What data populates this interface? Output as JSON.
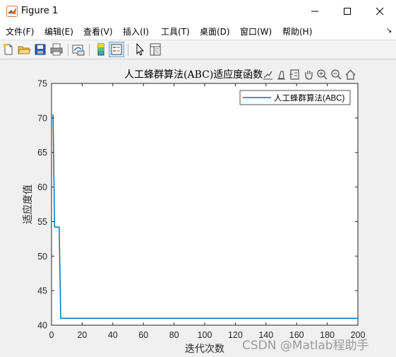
{
  "window": {
    "title": "Figure 1",
    "controls": [
      "minimize-icon",
      "maximize-icon",
      "close-icon"
    ]
  },
  "menu": {
    "items": [
      "文件(F)",
      "编辑(E)",
      "查看(V)",
      "插入(I)",
      "工具(T)",
      "桌面(D)",
      "窗口(W)",
      "帮助(H)"
    ],
    "overflow": "↘"
  },
  "toolbar": {
    "icons": [
      "new-figure-icon",
      "open-file-icon",
      "save-icon",
      "print-icon",
      "link-plot-icon",
      "colorbar-icon",
      "legend-icon",
      "edit-pointer-icon",
      "property-inspector-icon"
    ]
  },
  "axes_toolbar": {
    "icons": [
      "export-icon",
      "brush-icon",
      "datatip-icon",
      "pan-icon",
      "zoom-in-icon",
      "zoom-out-icon",
      "home-icon"
    ]
  },
  "watermark": "CSDN @Matlab程助手",
  "colors": {
    "line": "#0072bd",
    "axes_bg": "#ffffff",
    "figure_bg": "#f0f0f0"
  },
  "chart_data": {
    "type": "line",
    "title": "人工蜂群算法(ABC)适应度函数",
    "xlabel": "迭代次数",
    "ylabel": "适应度值",
    "xlim": [
      0,
      200
    ],
    "ylim": [
      40,
      75
    ],
    "xticks": [
      0,
      20,
      40,
      60,
      80,
      100,
      120,
      140,
      160,
      180,
      200
    ],
    "yticks": [
      40,
      45,
      50,
      55,
      60,
      65,
      70,
      75
    ],
    "legend_position": "top-right",
    "grid": false,
    "series": [
      {
        "name": "人工蜂群算法(ABC)",
        "x": [
          1,
          2,
          3,
          4,
          5,
          6,
          200
        ],
        "y": [
          70.5,
          54.2,
          54.2,
          54.2,
          54.2,
          41.0,
          41.0
        ]
      }
    ]
  }
}
